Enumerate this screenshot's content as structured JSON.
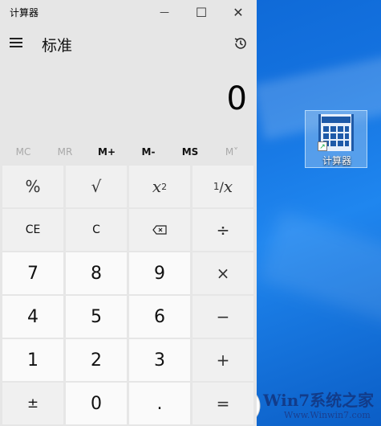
{
  "window": {
    "title": "计算器",
    "minimize_glyph": "—",
    "maximize_glyph": "☐",
    "close_glyph": "✕"
  },
  "header": {
    "mode": "标准"
  },
  "display": {
    "value": "0"
  },
  "memory": [
    {
      "label": "MC",
      "enabled": false
    },
    {
      "label": "MR",
      "enabled": false
    },
    {
      "label": "M+",
      "enabled": true
    },
    {
      "label": "M-",
      "enabled": true
    },
    {
      "label": "MS",
      "enabled": true
    },
    {
      "label": "M˅",
      "enabled": false
    }
  ],
  "keys": {
    "percent": "%",
    "sqrt": "√",
    "square_x": "x",
    "square_exp": "2",
    "reciprocal_num": "1",
    "reciprocal_den": "x",
    "ce": "CE",
    "c": "C",
    "divide": "÷",
    "k7": "7",
    "k8": "8",
    "k9": "9",
    "multiply": "×",
    "k4": "4",
    "k5": "5",
    "k6": "6",
    "minus": "−",
    "k1": "1",
    "k2": "2",
    "k3": "3",
    "plus": "+",
    "negate": "±",
    "k0": "0",
    "decimal": ".",
    "equals": "="
  },
  "desktop": {
    "icon_label": "计算器"
  },
  "watermark": {
    "text": "Win7系统之家",
    "url": "Www.Winwin7.com"
  }
}
